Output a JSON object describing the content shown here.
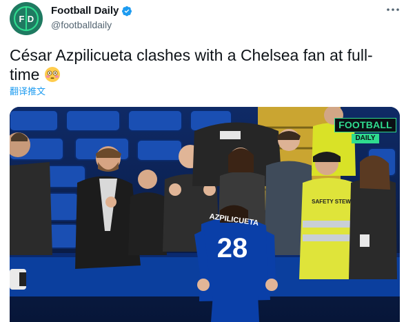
{
  "author": {
    "name": "Football Daily",
    "handle": "@footballdaily",
    "avatar_icon": "football-daily-logo",
    "verified_icon": "verified-badge-icon",
    "brand_color": "#1f7a61"
  },
  "tweet": {
    "text": "César Azpilicueta clashes with a Chelsea fan at full-time",
    "emoji": "flushed-face-emoji",
    "translate_label": "翻译推文"
  },
  "media": {
    "watermark_top": "FOOTBALL",
    "watermark_bottom": "DAILY",
    "player_name": "AZPILICUETA",
    "player_number": "28",
    "steward_vest_text": "SAFETY STEWARD"
  },
  "colors": {
    "accent_link": "#1d9bf0",
    "secondary_text": "#536471",
    "watermark_green": "#2fdc8f",
    "chelsea_blue": "#0a3fa8"
  }
}
